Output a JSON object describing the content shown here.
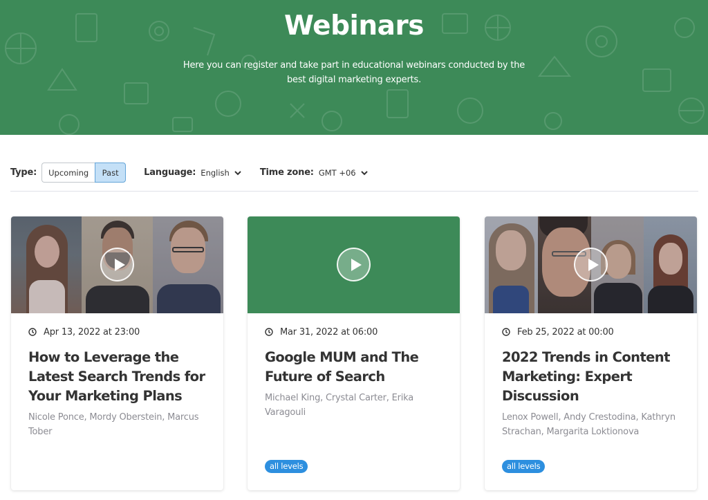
{
  "hero": {
    "title": "Webinars",
    "subtitle": "Here you can register and take part in educational webinars conducted by the best digital marketing experts.",
    "background_color": "#3d8a58"
  },
  "filters": {
    "type_label": "Type:",
    "type_options": [
      "Upcoming",
      "Past"
    ],
    "type_selected": "Past",
    "language_label": "Language:",
    "language_value": "English",
    "timezone_label": "Time zone:",
    "timezone_value": "GMT +06",
    "icons": {
      "dropdown": "chevron-down-icon"
    }
  },
  "cards": [
    {
      "thumbnail": "speaker-photos",
      "date": "Apr 13, 2022 at 23:00",
      "title": "How to Leverage the Latest Search Trends for Your Marketing Plans",
      "speakers": "Nicole Ponce, Mordy Oberstein, Marcus Tober",
      "badge": null
    },
    {
      "thumbnail": "green-placeholder",
      "date": "Mar 31, 2022 at 06:00",
      "title": "Google MUM and The Future of Search",
      "speakers": "Michael King, Crystal Carter, Erika Varagouli",
      "badge": "all levels"
    },
    {
      "thumbnail": "speaker-photos",
      "date": "Feb 25, 2022 at 00:00",
      "title": "2022 Trends in Content Marketing: Expert Discussion",
      "speakers": "Lenox Powell, Andy Crestodina, Kathryn Strachan, Margarita Loktionova",
      "badge": "all levels"
    }
  ],
  "colors": {
    "accent_green": "#3d8a58",
    "badge_blue": "#2d8fdf",
    "selected_tab_bg": "#c4e0f7",
    "text_dark": "#333333",
    "text_muted": "#8c8c93"
  }
}
